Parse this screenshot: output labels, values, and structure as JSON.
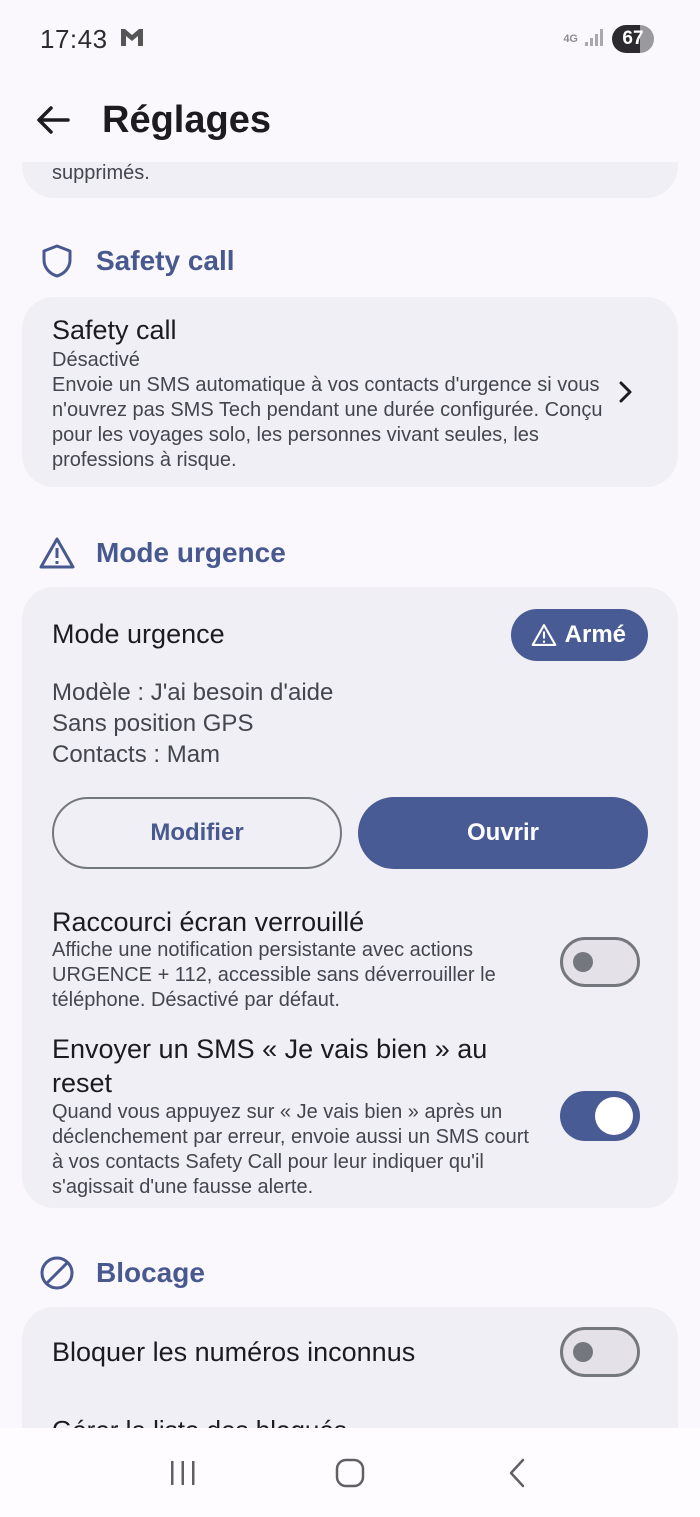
{
  "status_bar": {
    "time": "17:43",
    "network": "4G",
    "battery": "67"
  },
  "app_bar": {
    "title": "Réglages"
  },
  "prev_card": {
    "text": "supprimés."
  },
  "safety_section": {
    "title": "Safety call",
    "item": {
      "title": "Safety call",
      "status": "Désactivé",
      "description": "Envoie un SMS automatique à vos contacts d'urgence si vous n'ouvrez pas SMS Tech pendant une durée configurée. Conçu pour les voyages solo, les personnes vivant seules, les professions à risque."
    }
  },
  "urgence_section": {
    "title": "Mode urgence",
    "card": {
      "title": "Mode urgence",
      "badge": "Armé",
      "lines": [
        "Modèle : J'ai besoin d'aide",
        "Sans position GPS",
        "Contacts : Mam"
      ],
      "modify_label": "Modifier",
      "open_label": "Ouvrir"
    },
    "lock_shortcut": {
      "title": "Raccourci écran verrouillé",
      "description": "Affiche une notification persistante avec actions URGENCE + 112, accessible sans déverrouiller le téléphone. Désactivé par défaut.",
      "enabled": false
    },
    "reset_sms": {
      "title": "Envoyer un SMS « Je vais bien » au reset",
      "description": "Quand vous appuyez sur « Je vais bien » après un déclenchement par erreur, envoie aussi un SMS court à vos contacts Safety Call pour leur indiquer qu'il s'agissait d'une fausse alerte.",
      "enabled": true
    }
  },
  "blocage_section": {
    "title": "Blocage",
    "block_unknown": {
      "title": "Bloquer les numéros inconnus",
      "enabled": false
    },
    "next_item_partial": "Gérer la liste des bloqués"
  },
  "colors": {
    "accent": "#485b94",
    "accent_text": "#47598f",
    "card_bg": "#f0eff5",
    "page_bg": "#faf8fd"
  }
}
